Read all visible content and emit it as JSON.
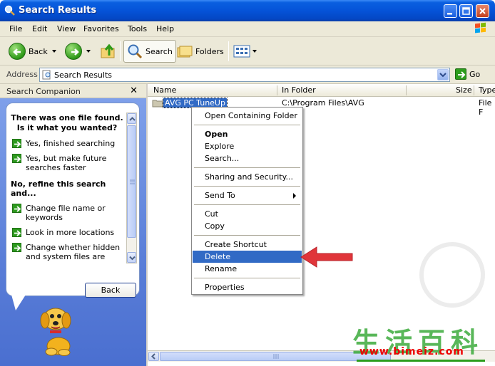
{
  "window": {
    "title": "Search Results"
  },
  "menubar": [
    "File",
    "Edit",
    "View",
    "Favorites",
    "Tools",
    "Help"
  ],
  "toolbar": {
    "back": "Back",
    "search": "Search",
    "folders": "Folders"
  },
  "address": {
    "label": "Address",
    "value": "Search Results",
    "go": "Go"
  },
  "companion": {
    "title": "Search Companion",
    "close": "✕",
    "question1": "There was one file found. Is it what you wanted?",
    "options1": [
      "Yes, finished searching",
      "Yes, but make future searches faster"
    ],
    "question2": "No, refine this search and...",
    "options2": [
      "Change file name or keywords",
      "Look in more locations",
      "Change whether hidden and system files are"
    ],
    "back_button": "Back"
  },
  "columns": [
    "Name",
    "In Folder",
    "Size",
    "Type"
  ],
  "results": [
    {
      "name": "AVG PC TuneUp",
      "folder": "C:\\Program Files\\AVG",
      "type": "File F"
    }
  ],
  "context_menu": {
    "items": [
      {
        "label": "Open Containing Folder",
        "bold": false
      },
      {
        "label": "Open",
        "bold": true
      },
      {
        "label": "Explore",
        "bold": false
      },
      {
        "label": "Search...",
        "bold": false
      },
      {
        "label": "Sharing and Security...",
        "bold": false
      },
      {
        "label": "Send To",
        "bold": false
      },
      {
        "label": "Cut",
        "bold": false
      },
      {
        "label": "Copy",
        "bold": false
      },
      {
        "label": "Create Shortcut",
        "bold": false
      },
      {
        "label": "Delete",
        "bold": false,
        "highlighted": true
      },
      {
        "label": "Rename",
        "bold": false
      },
      {
        "label": "Properties",
        "bold": false
      }
    ]
  },
  "watermark": {
    "chars": "生活百科",
    "url": "www.bimeiz.com"
  },
  "colors": {
    "title_bar": "#0553d8",
    "selection": "#316ac5",
    "arrow": "#e0353a"
  }
}
